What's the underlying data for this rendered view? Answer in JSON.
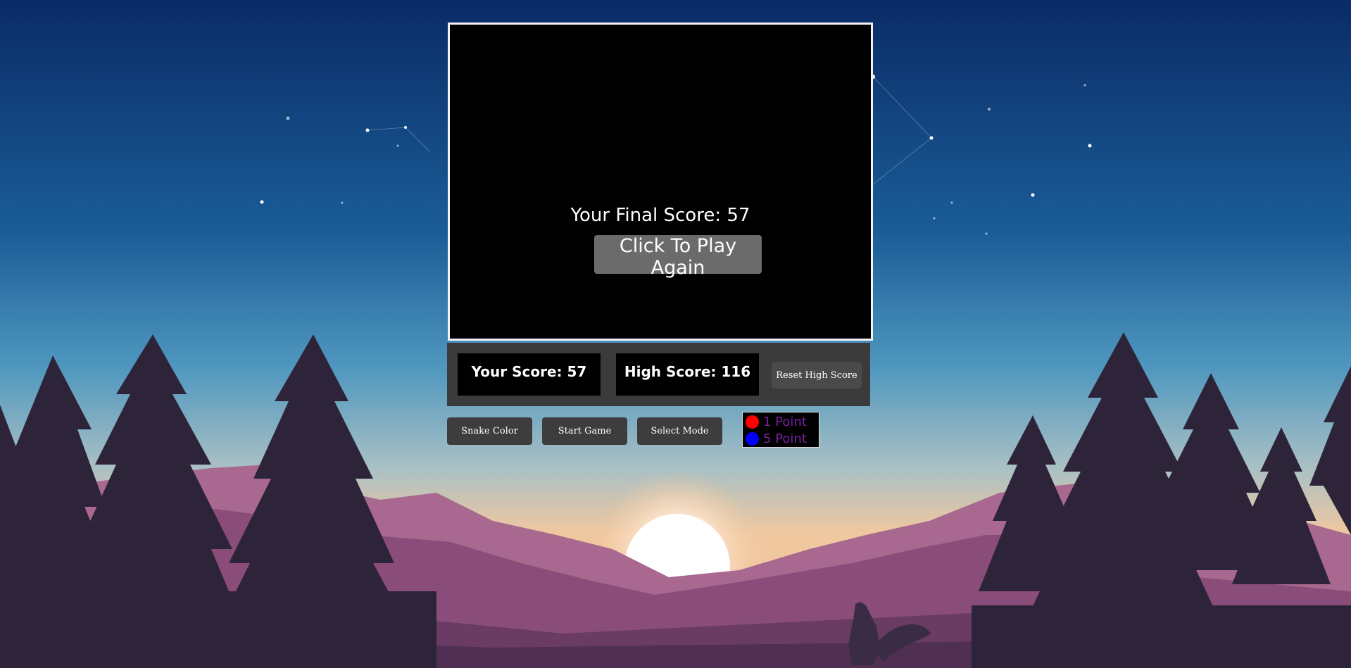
{
  "game": {
    "final_score_text": "Your Final Score: 57",
    "play_again_label": "Click To Play Again"
  },
  "scoreboard": {
    "your_score_text": "Your Score: 57",
    "high_score_text": "High Score: 116",
    "reset_label": "Reset High Score"
  },
  "controls": {
    "snake_color_label": "Snake Color",
    "start_game_label": "Start Game",
    "select_mode_label": "Select Mode"
  },
  "legend": {
    "items": [
      {
        "color": "#ff0000",
        "label": "1 Point"
      },
      {
        "color": "#0000ff",
        "label": "5 Point"
      }
    ]
  },
  "colors": {
    "sky_top": "#0a2b66",
    "sky_mid": "#1f6fa6",
    "horizon": "#f3c9a0",
    "tree": "#2e243a",
    "mountain": "#8a4d7a"
  }
}
